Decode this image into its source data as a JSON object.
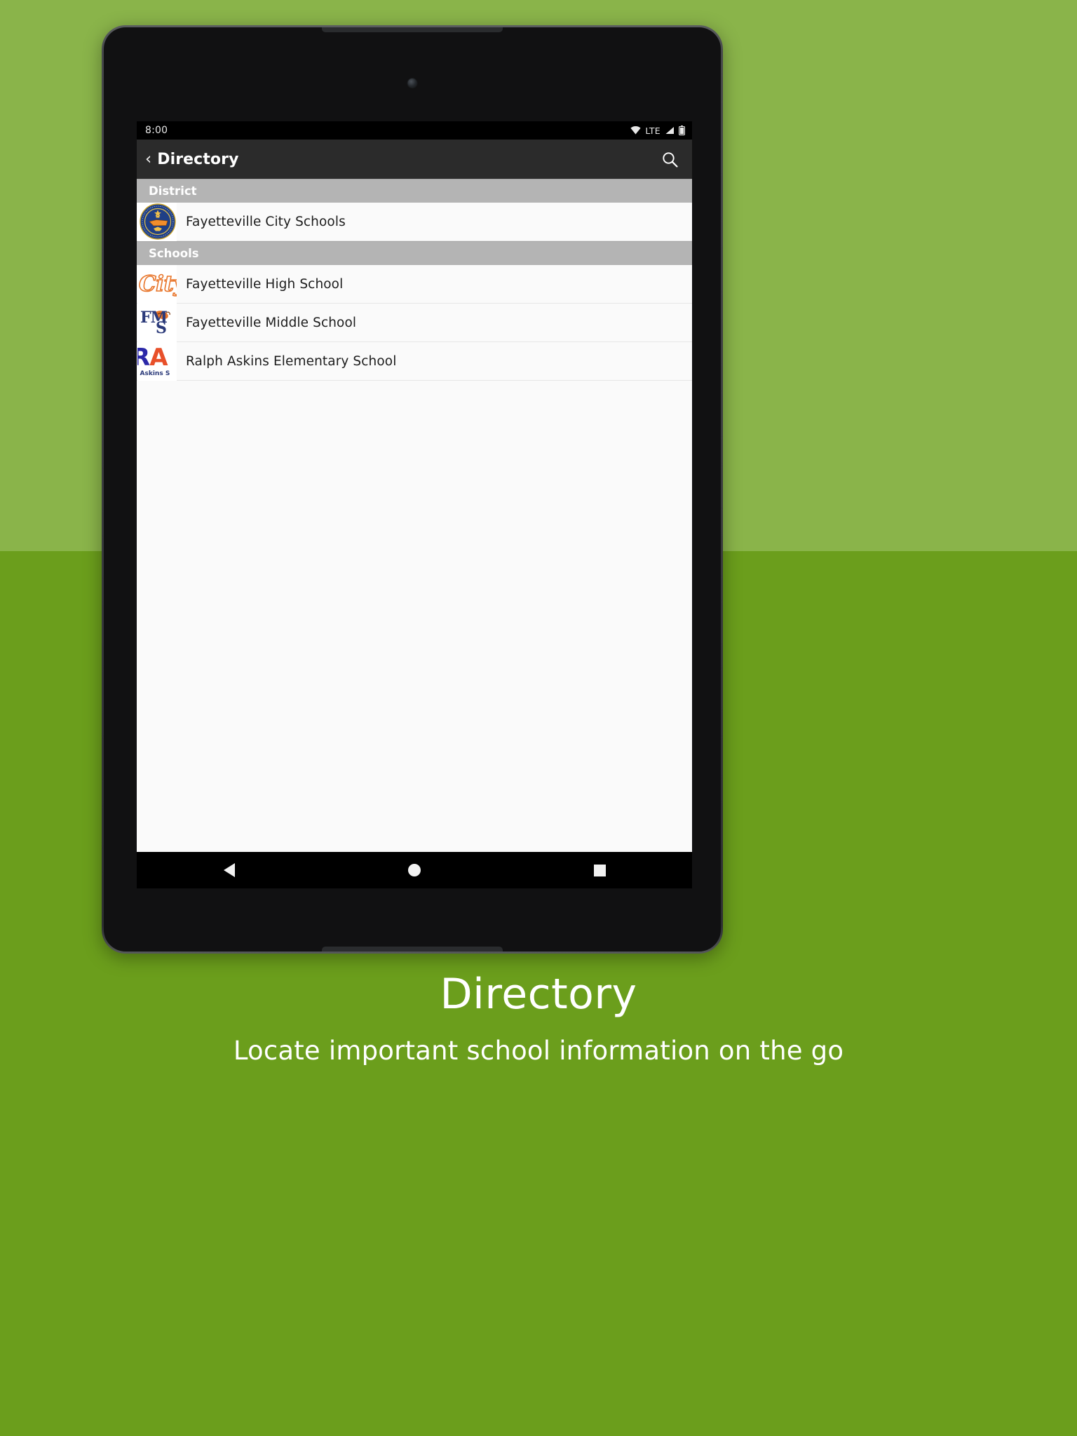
{
  "background": {
    "color_top": "#8ab44a",
    "color_bottom": "#6b9e1c"
  },
  "device": {
    "type": "android-tablet"
  },
  "statusbar": {
    "time": "8:00",
    "lte_label": "LTE",
    "icons": [
      "wifi-icon",
      "lte-label",
      "signal-icon",
      "battery-icon"
    ]
  },
  "appbar": {
    "back_label": "‹",
    "title": "Directory",
    "search_icon": "search-icon"
  },
  "list": {
    "sections": [
      {
        "header": "District",
        "rows": [
          {
            "label": "Fayetteville City Schools",
            "logo": "fayetteville-city-schools-seal",
            "logo_text": "FAYETTEVILLE CITY SCHOOL SYSTEM",
            "logo_colors": {
              "ring": "#1f3f86",
              "accent": "#f2a33c",
              "state": "#f28e2c"
            }
          }
        ]
      },
      {
        "header": "Schools",
        "rows": [
          {
            "label": "Fayetteville High School",
            "logo": "city-script-logo",
            "logo_text": "City",
            "logo_colors": {
              "outline": "#e8752a"
            }
          },
          {
            "label": "Fayetteville Middle School",
            "logo": "fms-tiger-logo",
            "logo_text": "FMS",
            "logo_colors": {
              "letters": "#2b3a7a",
              "tiger": "#e8752a"
            }
          },
          {
            "label": "Ralph Askins Elementary School",
            "logo": "ralph-askins-logo",
            "logo_text": "RA",
            "logo_subtext": "h Askins S",
            "logo_colors": {
              "blue": "#2b28a8",
              "orange": "#e8502a"
            }
          }
        ]
      }
    ]
  },
  "navbar": {
    "back": "nav-back-button",
    "home": "nav-home-button",
    "recents": "nav-recents-button"
  },
  "caption": {
    "title": "Directory",
    "subtitle": "Locate important school information on the go"
  }
}
